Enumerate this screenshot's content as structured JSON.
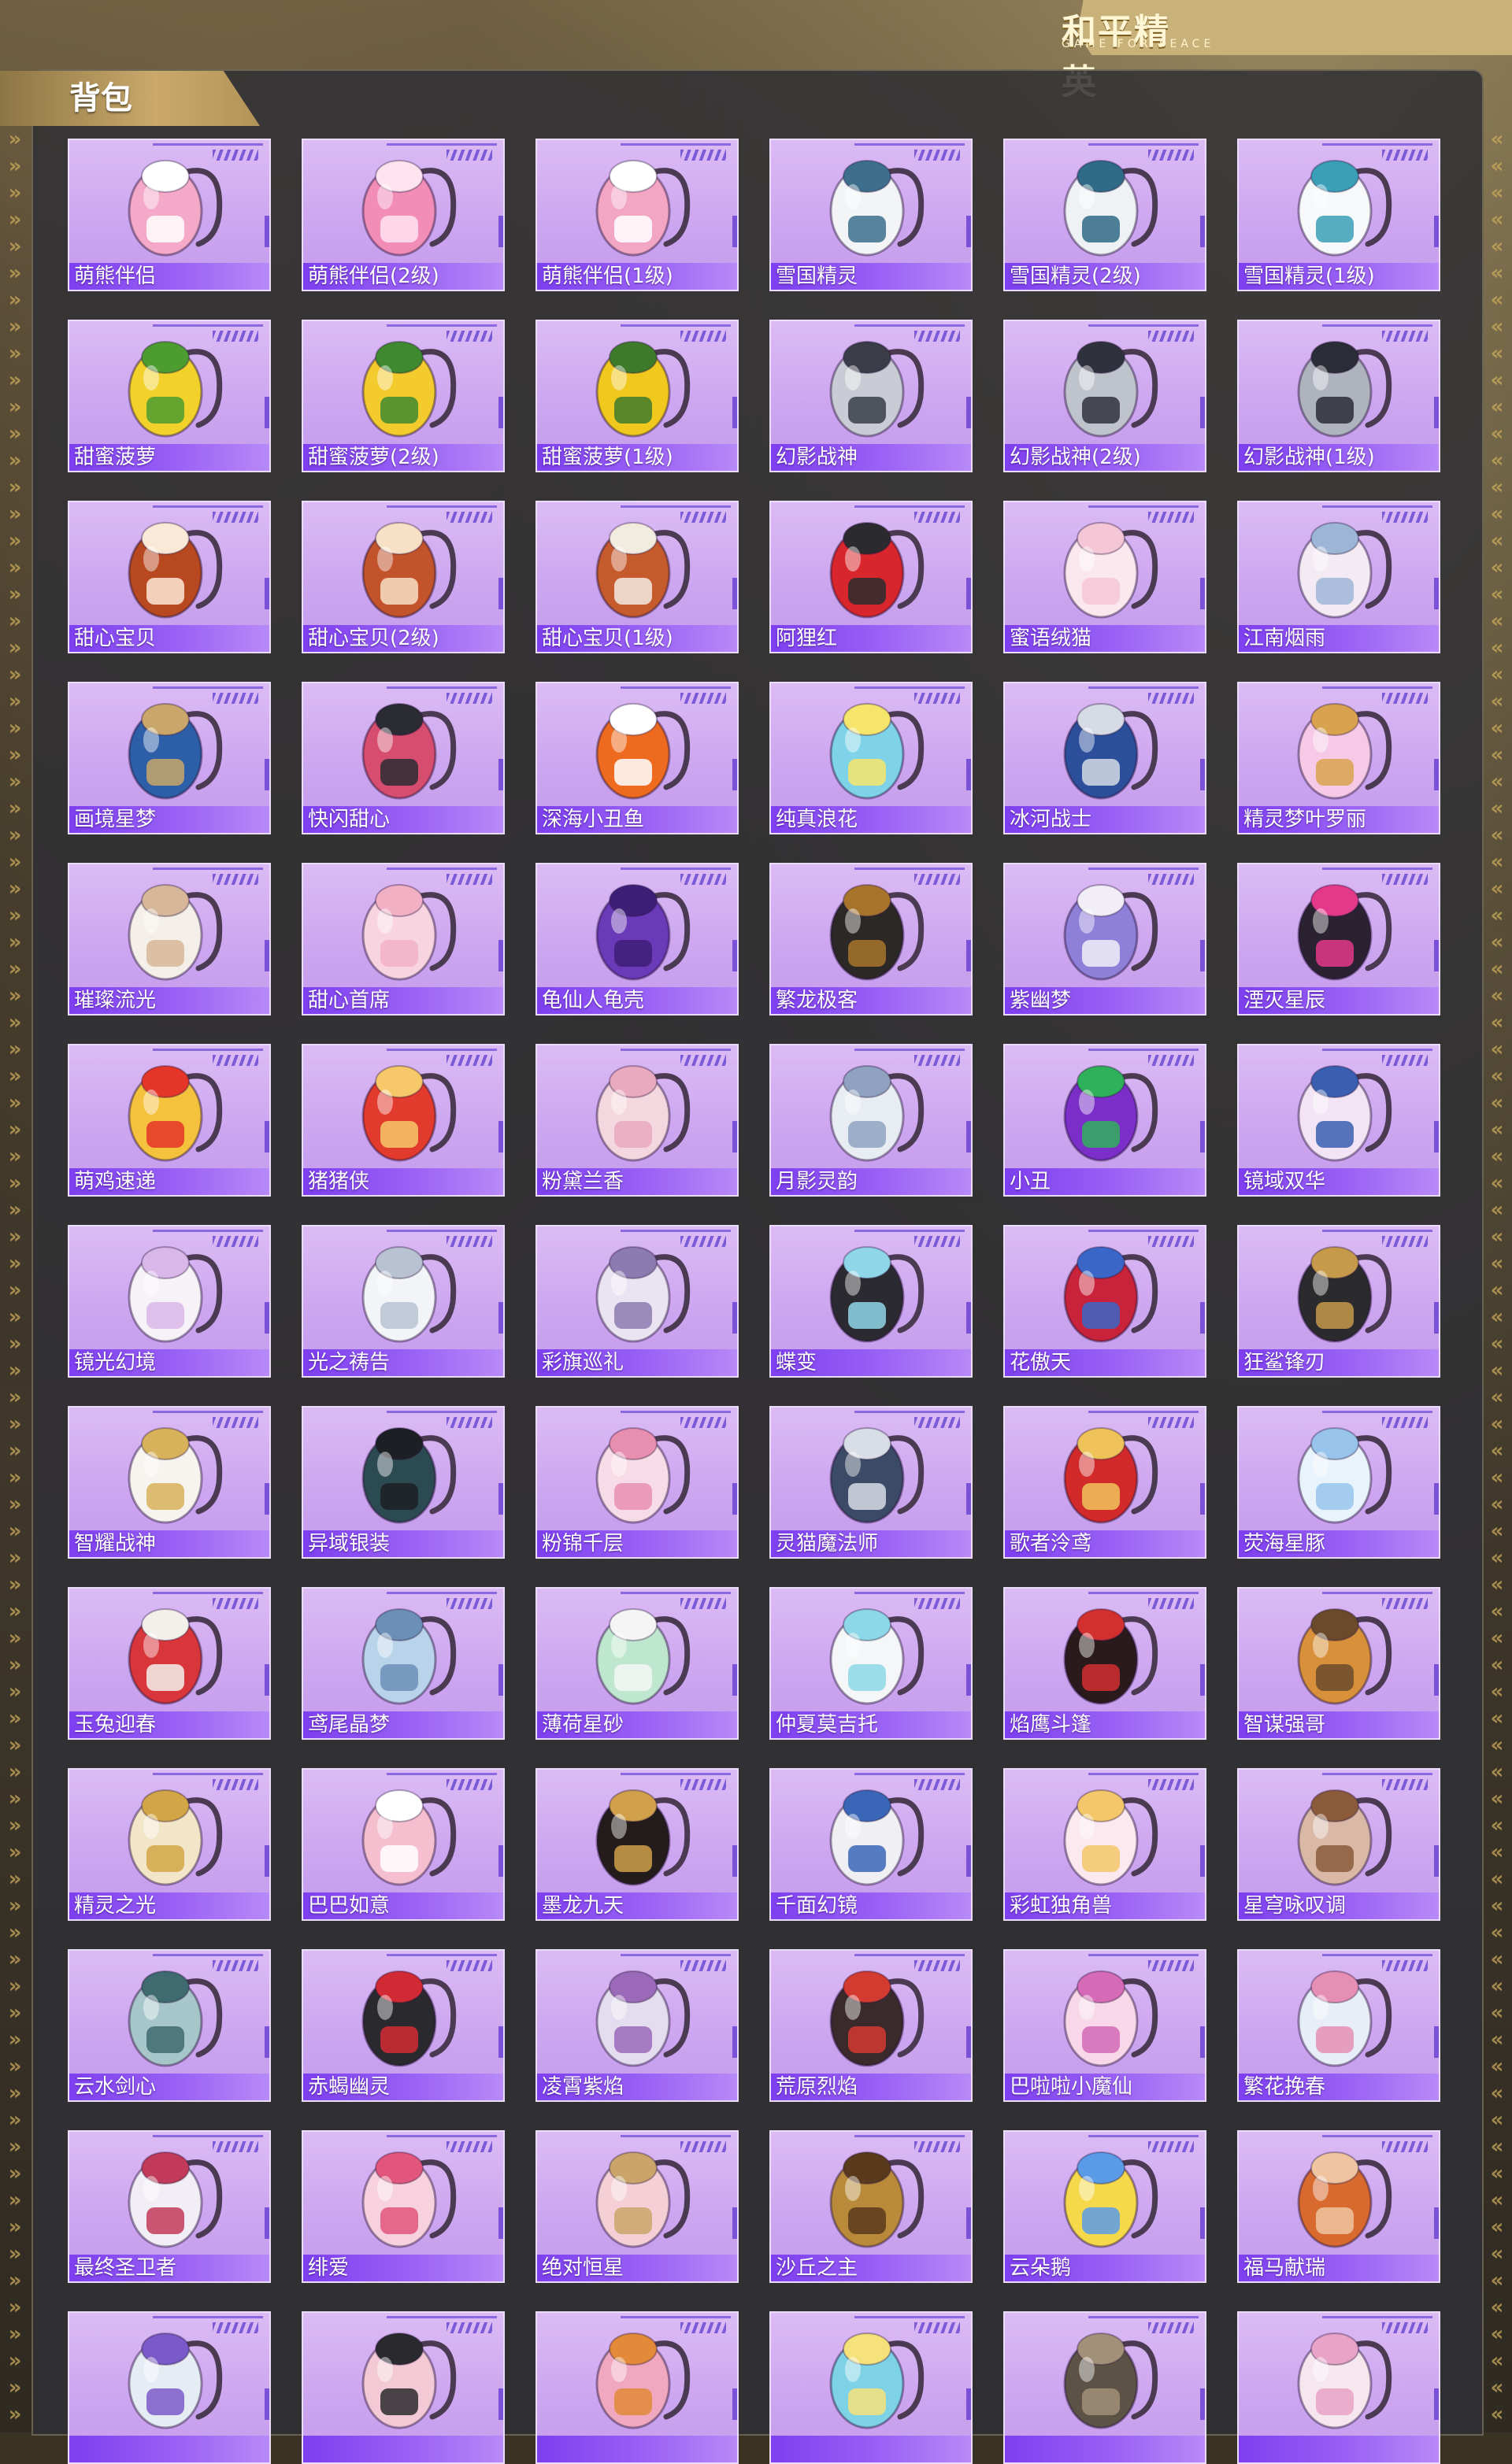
{
  "logo": {
    "main": "和平精英",
    "sub": "GAME FOR PEACE"
  },
  "section": {
    "title": "背包"
  },
  "colors": {
    "card_bg": "#cda6f0",
    "label_bar": "#8a4ff2",
    "accent": "#c9a95a"
  },
  "items": [
    {
      "name": "萌熊伴侣",
      "icon": "pink-bear-backpack",
      "c1": "#f4a9c8",
      "c2": "#ffffff"
    },
    {
      "name": "萌熊伴侣(2级)",
      "icon": "pink-bear-backpack",
      "c1": "#f28db8",
      "c2": "#ffe3ef"
    },
    {
      "name": "萌熊伴侣(1级)",
      "icon": "pink-bear-backpack",
      "c1": "#f3a5c4",
      "c2": "#ffffff"
    },
    {
      "name": "雪国精灵",
      "icon": "snowman-backpack",
      "c1": "#f2f4f6",
      "c2": "#3d6f8c"
    },
    {
      "name": "雪国精灵(2级)",
      "icon": "snowman-backpack",
      "c1": "#eef2f4",
      "c2": "#2f6b86"
    },
    {
      "name": "雪国精灵(1级)",
      "icon": "snowman-backpack",
      "c1": "#f6f8f9",
      "c2": "#3aa0b8"
    },
    {
      "name": "甜蜜菠萝",
      "icon": "pineapple-backpack",
      "c1": "#f1d12a",
      "c2": "#4c9c2f"
    },
    {
      "name": "甜蜜菠萝(2级)",
      "icon": "pineapple-backpack",
      "c1": "#f3cb2c",
      "c2": "#3f8a30"
    },
    {
      "name": "甜蜜菠萝(1级)",
      "icon": "pineapple-backpack",
      "c1": "#f0c81e",
      "c2": "#3d7a2a"
    },
    {
      "name": "幻影战神",
      "icon": "armored-backpack",
      "c1": "#c9ccd4",
      "c2": "#3a3d48"
    },
    {
      "name": "幻影战神(2级)",
      "icon": "armored-backpack",
      "c1": "#bfc3cc",
      "c2": "#2f323c"
    },
    {
      "name": "幻影战神(1级)",
      "icon": "armored-backpack",
      "c1": "#aeb3bd",
      "c2": "#2a2c36"
    },
    {
      "name": "甜心宝贝",
      "icon": "dessert-backpack",
      "c1": "#b8481f",
      "c2": "#fbe9d8"
    },
    {
      "name": "甜心宝贝(2级)",
      "icon": "dessert-backpack",
      "c1": "#c2532a",
      "c2": "#f7e0c6"
    },
    {
      "name": "甜心宝贝(1级)",
      "icon": "dessert-backpack",
      "c1": "#c55a2d",
      "c2": "#f2ebe0"
    },
    {
      "name": "阿狸红",
      "icon": "red-fox-backpack",
      "c1": "#d8262c",
      "c2": "#2b2b2f"
    },
    {
      "name": "蜜语绒猫",
      "icon": "plush-cat-backpack",
      "c1": "#fbe7ee",
      "c2": "#f5c6d6"
    },
    {
      "name": "江南烟雨",
      "icon": "ornament-backpack",
      "c1": "#f3eaf4",
      "c2": "#9db6d6"
    },
    {
      "name": "画境星梦",
      "icon": "mirror-frame-backpack",
      "c1": "#2d5fa8",
      "c2": "#c9a66a"
    },
    {
      "name": "快闪甜心",
      "icon": "heart-speaker-backpack",
      "c1": "#d64d6f",
      "c2": "#2b2b34"
    },
    {
      "name": "深海小丑鱼",
      "icon": "clownfish-backpack",
      "c1": "#ee6a1f",
      "c2": "#ffffff"
    },
    {
      "name": "纯真浪花",
      "icon": "drink-cup-backpack",
      "c1": "#7ed3e8",
      "c2": "#f6e56b"
    },
    {
      "name": "冰河战士",
      "icon": "school-backpack",
      "c1": "#2c4f9c",
      "c2": "#d6dbe6"
    },
    {
      "name": "精灵梦叶罗丽",
      "icon": "heart-crystal-backpack",
      "c1": "#f6c9e6",
      "c2": "#d9a24e"
    },
    {
      "name": "璀璨流光",
      "icon": "bow-backpack",
      "c1": "#f4efe8",
      "c2": "#d6b79a"
    },
    {
      "name": "甜心首席",
      "icon": "pink-bag-backpack",
      "c1": "#f7d4e0",
      "c2": "#f2b0c5"
    },
    {
      "name": "龟仙人龟壳",
      "icon": "turtle-shell-backpack",
      "c1": "#6a3ab8",
      "c2": "#3e1f78"
    },
    {
      "name": "繁龙极客",
      "icon": "dragon-backpack",
      "c1": "#2c2826",
      "c2": "#a8742c"
    },
    {
      "name": "紫幽梦",
      "icon": "purple-bunny-backpack",
      "c1": "#8e7fd8",
      "c2": "#f1eef8"
    },
    {
      "name": "湮灭星辰",
      "icon": "star-blade-backpack",
      "c1": "#2a2230",
      "c2": "#e4388a"
    },
    {
      "name": "萌鸡速递",
      "icon": "chicken-backpack",
      "c1": "#f5c23e",
      "c2": "#e43528"
    },
    {
      "name": "猪猪侠",
      "icon": "pig-hero-backpack",
      "c1": "#e23a2c",
      "c2": "#f7c86a"
    },
    {
      "name": "粉黛兰香",
      "icon": "pink-fan-backpack",
      "c1": "#f4d7df",
      "c2": "#e9a9bf"
    },
    {
      "name": "月影灵韵",
      "icon": "moon-backpack",
      "c1": "#e8edf3",
      "c2": "#8fa3c0"
    },
    {
      "name": "小丑",
      "icon": "jester-backpack",
      "c1": "#7b2fc8",
      "c2": "#2fb05a"
    },
    {
      "name": "镜域双华",
      "icon": "wing-backpack",
      "c1": "#f2e4f4",
      "c2": "#3a5fb0"
    },
    {
      "name": "镜光幻境",
      "icon": "white-wing-backpack",
      "c1": "#f6f2f8",
      "c2": "#d9b7e8"
    },
    {
      "name": "光之祷告",
      "icon": "crown-wing-backpack",
      "c1": "#f2f4f7",
      "c2": "#b8c2d2"
    },
    {
      "name": "彩旗巡礼",
      "icon": "clock-backpack",
      "c1": "#e9e3f2",
      "c2": "#8c7bb0"
    },
    {
      "name": "蝶变",
      "icon": "butterfly-backpack",
      "c1": "#2a2a30",
      "c2": "#8fd6e8"
    },
    {
      "name": "花傲天",
      "icon": "helmet-backpack",
      "c1": "#c8233a",
      "c2": "#3a66c8"
    },
    {
      "name": "狂鲨锋刃",
      "icon": "shark-backpack",
      "c1": "#2b2a2c",
      "c2": "#c69a4a"
    },
    {
      "name": "智耀战神",
      "icon": "angel-backpack",
      "c1": "#f7f3ee",
      "c2": "#d8b25a"
    },
    {
      "name": "异域银装",
      "icon": "tactical-backpack",
      "c1": "#2c4a52",
      "c2": "#1c2024"
    },
    {
      "name": "粉锦千层",
      "icon": "ribbon-backpack",
      "c1": "#f7dbe6",
      "c2": "#e88fb0"
    },
    {
      "name": "灵猫魔法师",
      "icon": "magic-cat-backpack",
      "c1": "#3b4a66",
      "c2": "#d8dde6"
    },
    {
      "name": "歌者泠鸢",
      "icon": "red-pouch-backpack",
      "c1": "#d22a2a",
      "c2": "#f0c35a"
    },
    {
      "name": "荧海星豚",
      "icon": "dolphin-backpack",
      "c1": "#e9f3fb",
      "c2": "#98c4ec"
    },
    {
      "name": "玉兔迎春",
      "icon": "red-rabbit-backpack",
      "c1": "#d9363c",
      "c2": "#f3f0ec"
    },
    {
      "name": "鸢尾晶梦",
      "icon": "crystal-ball-backpack",
      "c1": "#b9d4ea",
      "c2": "#6c8fb8"
    },
    {
      "name": "薄荷星砂",
      "icon": "mint-pouch-backpack",
      "c1": "#bfe7cf",
      "c2": "#f5f5f5"
    },
    {
      "name": "仲夏莫吉托",
      "icon": "cup-backpack",
      "c1": "#f4f6f7",
      "c2": "#8dd8e8"
    },
    {
      "name": "焰鹰斗篷",
      "icon": "eagle-backpack",
      "c1": "#2a1a1c",
      "c2": "#d22f2f"
    },
    {
      "name": "智谋强哥",
      "icon": "bear-plush-backpack",
      "c1": "#d8913a",
      "c2": "#6b4a2c"
    },
    {
      "name": "精灵之光",
      "icon": "fairy-backpack",
      "c1": "#f3e6c8",
      "c2": "#d2a646"
    },
    {
      "name": "巴巴如意",
      "icon": "pink-pig-backpack",
      "c1": "#f5bfd0",
      "c2": "#ffffff"
    },
    {
      "name": "墨龙九天",
      "icon": "black-dragon-backpack",
      "c1": "#241c1a",
      "c2": "#d0a04a"
    },
    {
      "name": "千面幻镜",
      "icon": "mask-backpack",
      "c1": "#f0f0f4",
      "c2": "#3a66b8"
    },
    {
      "name": "彩虹独角兽",
      "icon": "unicorn-backpack",
      "c1": "#fbe9ef",
      "c2": "#f3c76a"
    },
    {
      "name": "星穹咏叹调",
      "icon": "chest-backpack",
      "c1": "#d9b8a6",
      "c2": "#8a5a3a"
    },
    {
      "name": "云水剑心",
      "icon": "sword-backpack",
      "c1": "#a6c6c9",
      "c2": "#3e6a70"
    },
    {
      "name": "赤蝎幽灵",
      "icon": "scorpion-backpack",
      "c1": "#2a2a2e",
      "c2": "#d22a34"
    },
    {
      "name": "凌霄紫焰",
      "icon": "violet-ornament-backpack",
      "c1": "#e4dcef",
      "c2": "#9a6ab8"
    },
    {
      "name": "荒原烈焰",
      "icon": "flame-backpack",
      "c1": "#3a2a2c",
      "c2": "#d33a30"
    },
    {
      "name": "巴啦啦小魔仙",
      "icon": "magic-fairy-backpack",
      "c1": "#f8d7e8",
      "c2": "#d56ab6"
    },
    {
      "name": "繁花挽春",
      "icon": "flower-backpack",
      "c1": "#e7eef8",
      "c2": "#e58fb4"
    },
    {
      "name": "最终圣卫者",
      "icon": "mecha-wing-backpack",
      "c1": "#f2eef6",
      "c2": "#c23a5a"
    },
    {
      "name": "绯爱",
      "icon": "pink-heart-backpack",
      "c1": "#f8d1de",
      "c2": "#e2567e"
    },
    {
      "name": "绝对恒星",
      "icon": "collage-backpack",
      "c1": "#f4d0d6",
      "c2": "#caa46a"
    },
    {
      "name": "沙丘之主",
      "icon": "sand-scroll-backpack",
      "c1": "#b88a3a",
      "c2": "#5a3a1c"
    },
    {
      "name": "云朵鹅",
      "icon": "duck-backpack",
      "c1": "#f6d94a",
      "c2": "#5a9be8"
    },
    {
      "name": "福马献瑞",
      "icon": "horse-backpack",
      "c1": "#d86a30",
      "c2": "#f0c4a0"
    },
    {
      "name": "",
      "icon": "penguin-backpack",
      "c1": "#e6ecf3",
      "c2": "#7a5ac8"
    },
    {
      "name": "",
      "icon": "quilted-bag-backpack",
      "c1": "#f4c9d6",
      "c2": "#2a2a2e"
    },
    {
      "name": "",
      "icon": "donut-backpack",
      "c1": "#f0a8c0",
      "c2": "#e28a3a"
    },
    {
      "name": "",
      "icon": "aqua-shell-backpack",
      "c1": "#7ed2e6",
      "c2": "#f6e27a"
    },
    {
      "name": "",
      "icon": "rugged-backpack",
      "c1": "#5c5246",
      "c2": "#a29078"
    },
    {
      "name": "",
      "icon": "pink-llama-backpack",
      "c1": "#f6e6ee",
      "c2": "#e8a3c6"
    }
  ]
}
